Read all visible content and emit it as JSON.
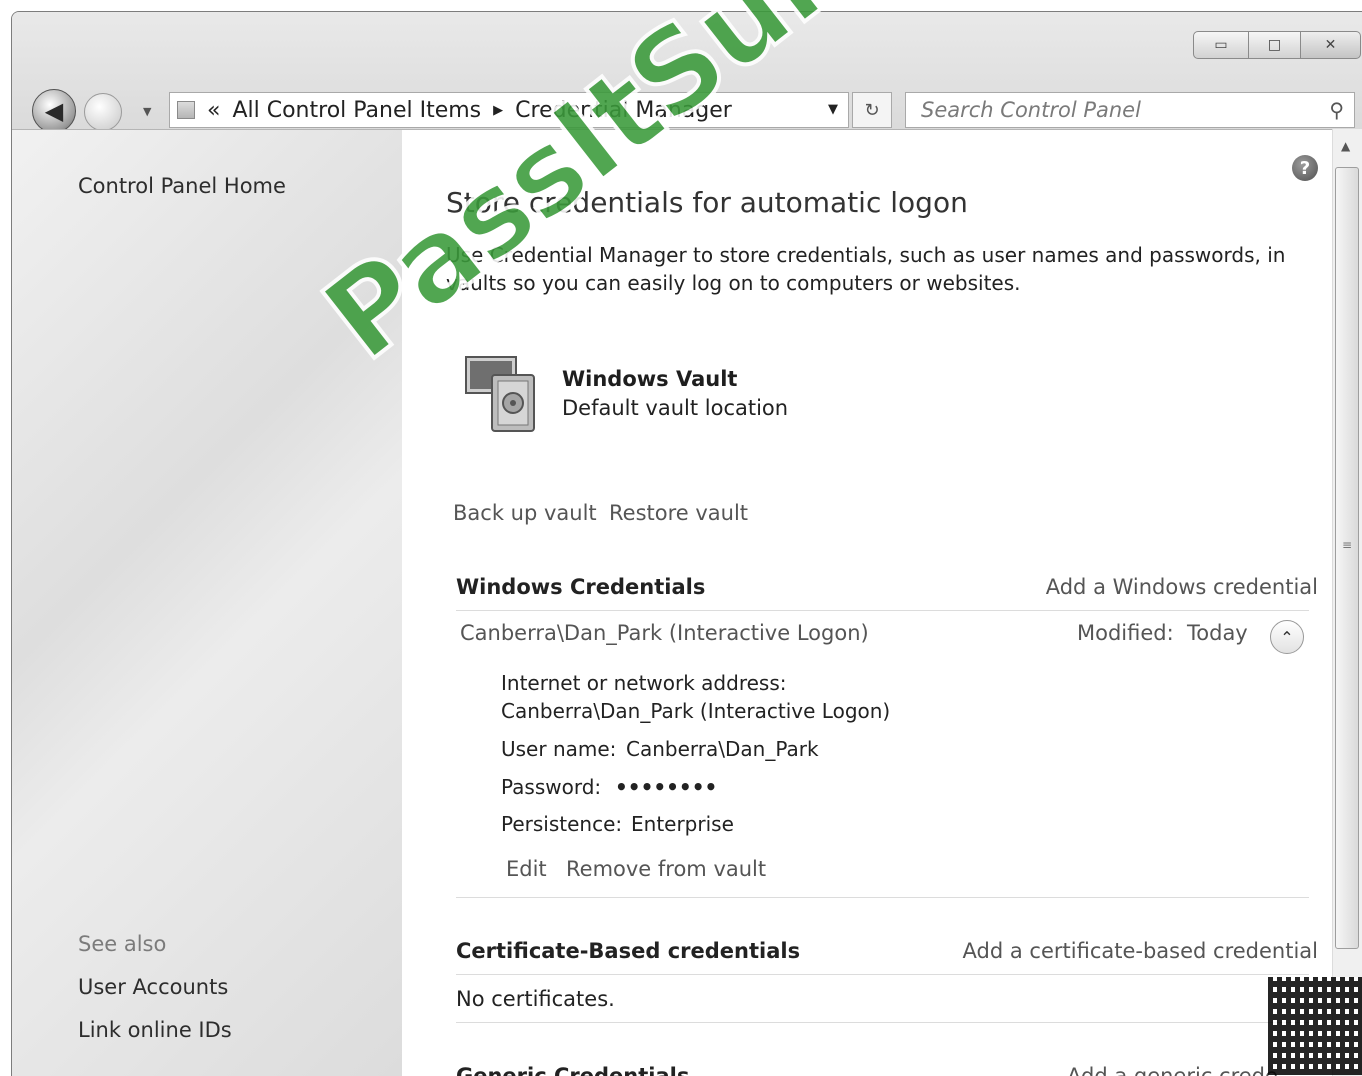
{
  "nav": {
    "back_icon": "back-arrow-icon",
    "address_root": "«",
    "address_crumb1": "All Control Panel Items",
    "address_sep": "▶",
    "address_crumb2": "Credential Manager",
    "search_placeholder": "Search Control Panel"
  },
  "window_controls": {
    "minimize": "▭",
    "maximize": "□",
    "close": "✕"
  },
  "sidebar": {
    "home": "Control Panel Home",
    "see_also": "See also",
    "items": [
      "User Accounts",
      "Link online IDs"
    ]
  },
  "main": {
    "title": "Store credentials for automatic logon",
    "description_line1": "Use Credential Manager to store credentials, such as user names and passwords, in",
    "description_line2": "vaults so you can easily log on to computers or websites.",
    "vault_name": "Windows Vault",
    "vault_location": "Default vault location",
    "backup_link": "Back up vault",
    "restore_link": "Restore vault",
    "windows_credentials": {
      "title": "Windows Credentials",
      "add_link": "Add a Windows credential",
      "entry_name": "Canberra\\Dan_Park (Interactive Logon)",
      "modified_label": "Modified:",
      "modified_value": "Today",
      "address_label": "Internet or network address:",
      "address_value": "Canberra\\Dan_Park (Interactive Logon)",
      "username_label": "User name:",
      "username_value": "Canberra\\Dan_Park",
      "password_label": "Password:",
      "password_value": "••••••••",
      "persistence_label": "Persistence:",
      "persistence_value": "Enterprise",
      "edit_link": "Edit",
      "remove_link": "Remove from vault"
    },
    "certificate_credentials": {
      "title": "Certificate-Based credentials",
      "add_link": "Add a certificate-based credential",
      "empty_text": "No certificates."
    },
    "generic_credentials": {
      "title": "Generic Credentials",
      "add_link": "Add a generic crede"
    }
  },
  "watermark": "PassItSure.com"
}
